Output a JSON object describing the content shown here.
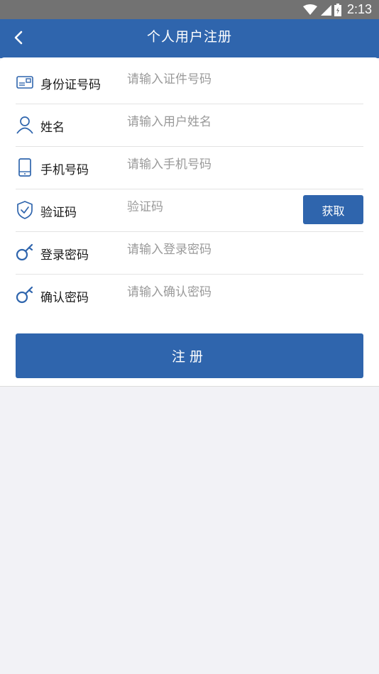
{
  "status_bar": {
    "time": "2:13",
    "icons": [
      "wifi-icon",
      "signal-icon",
      "battery-icon"
    ]
  },
  "header": {
    "title": "个人用户注册",
    "back_icon": "chevron-left-icon"
  },
  "form": {
    "rows": [
      {
        "icon": "id-card-icon",
        "label": "身份证号码",
        "placeholder": "请输入证件号码"
      },
      {
        "icon": "user-icon",
        "label": "姓名",
        "placeholder": "请输入用户姓名"
      },
      {
        "icon": "phone-icon",
        "label": "手机号码",
        "placeholder": "请输入手机号码"
      },
      {
        "icon": "shield-check-icon",
        "label": "验证码",
        "placeholder": "验证码"
      },
      {
        "icon": "key-icon",
        "label": "登录密码",
        "placeholder": "请输入登录密码"
      },
      {
        "icon": "key-icon",
        "label": "确认密码",
        "placeholder": "请输入确认密码"
      }
    ],
    "get_code_label": "获取",
    "submit_label": "注册"
  },
  "colors": {
    "primary": "#2f65ad",
    "status_bar": "#727272",
    "background": "#f2f2f6"
  }
}
